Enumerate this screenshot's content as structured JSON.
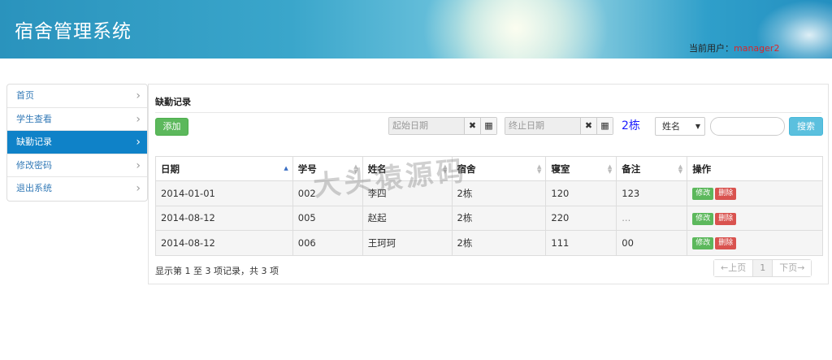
{
  "header": {
    "title": "宿舍管理系统",
    "user_label": "当前用户：",
    "user_name": "manager2"
  },
  "sidebar": {
    "items": [
      {
        "label": "首页",
        "active": false
      },
      {
        "label": "学生查看",
        "active": false
      },
      {
        "label": "缺勤记录",
        "active": true
      },
      {
        "label": "修改密码",
        "active": false
      },
      {
        "label": "退出系统",
        "active": false
      }
    ]
  },
  "panel": {
    "title": "缺勤记录"
  },
  "toolbar": {
    "add_label": "添加",
    "start_date_placeholder": "起始日期",
    "end_date_placeholder": "终止日期",
    "building": "2栋",
    "search_field": "姓名",
    "search_value": "",
    "search_label": "搜索"
  },
  "table": {
    "columns": [
      "日期",
      "学号",
      "姓名",
      "宿舍",
      "寝室",
      "备注",
      "操作"
    ],
    "rows": [
      [
        "2014-01-01",
        "002",
        "李四",
        "2栋",
        "120",
        "123"
      ],
      [
        "2014-08-12",
        "005",
        "赵起",
        "2栋",
        "220",
        "..."
      ],
      [
        "2014-08-12",
        "006",
        "王珂珂",
        "2栋",
        "111",
        "00"
      ]
    ],
    "edit_label": "修改",
    "delete_label": "删除"
  },
  "footer": {
    "summary": "显示第 1 至 3 项记录，共 3 项"
  },
  "pager": {
    "prev": "←上页",
    "current": "1",
    "next": "下页→"
  },
  "watermark": "大头猿源码",
  "colors": {
    "accent": "#0f82c8",
    "add_button": "#5cb85c",
    "delete_button": "#d9534f",
    "search_button": "#5bc0de",
    "username": "#d9262b"
  }
}
